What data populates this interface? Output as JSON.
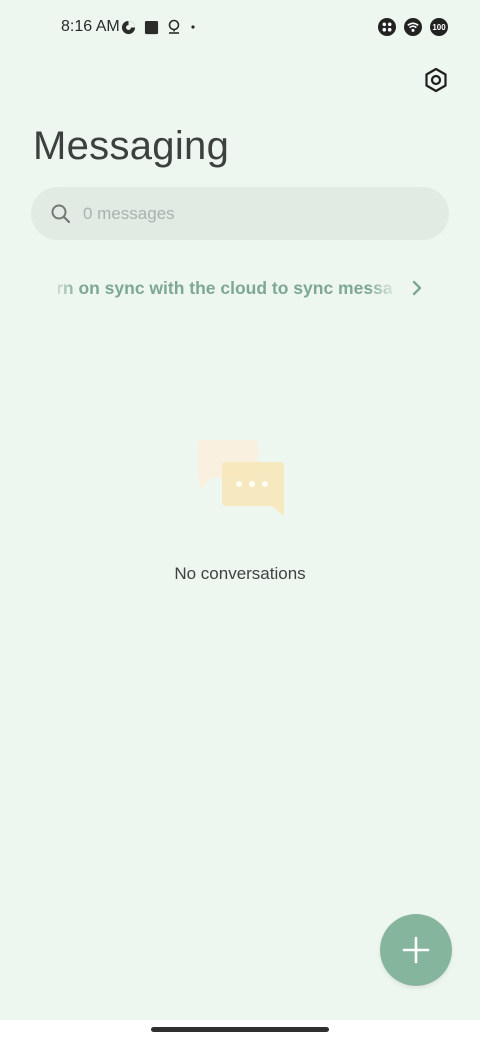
{
  "status_bar": {
    "time": "8:16 AM",
    "battery_level": "100",
    "icons": [
      "data-saver-icon",
      "square-notification-icon",
      "location-icon",
      "dot-icon",
      "app-grid-icon",
      "wifi-icon",
      "battery-icon"
    ]
  },
  "header": {
    "title": "Messaging",
    "settings_icon": "settings-icon"
  },
  "search": {
    "placeholder": "0 messages",
    "value": ""
  },
  "sync_banner": {
    "text": "Turn on sync with the cloud to sync messages"
  },
  "empty_state": {
    "text": "No conversations",
    "illustration": "chat-bubbles-illustration"
  },
  "fab": {
    "icon": "plus-icon"
  },
  "colors": {
    "background": "#edf6ef",
    "accent": "#86b59e",
    "sync_text": "#7ea893",
    "search_bg": "#e1ebe4"
  }
}
